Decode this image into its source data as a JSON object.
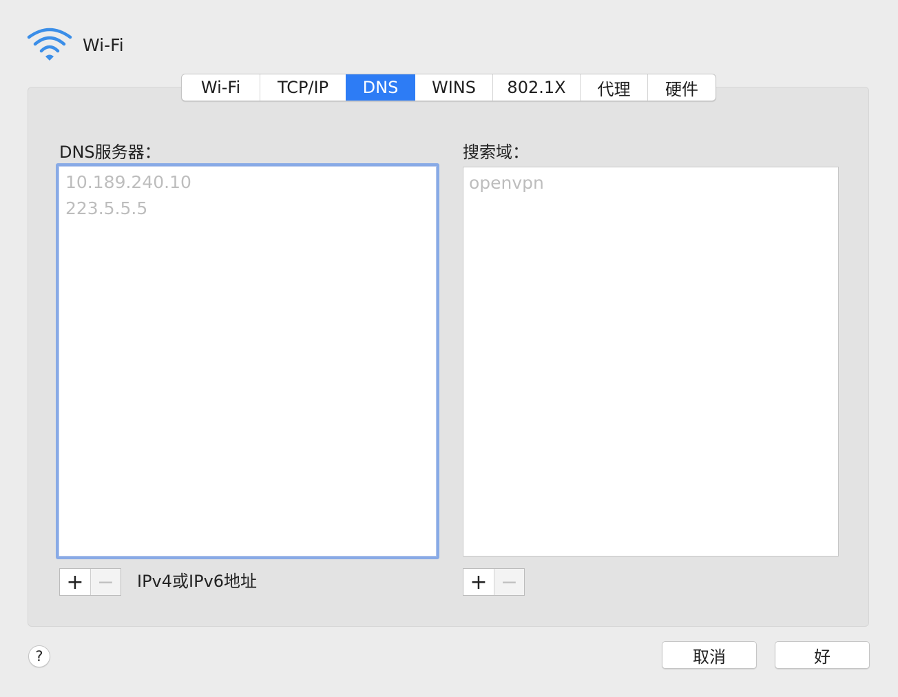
{
  "window": {
    "title": "Wi-Fi",
    "icon": "wifi-icon",
    "accent_color": "#2d7cf5"
  },
  "tabs": [
    {
      "label": "Wi-Fi",
      "active": false
    },
    {
      "label": "TCP/IP",
      "active": false
    },
    {
      "label": "DNS",
      "active": true
    },
    {
      "label": "WINS",
      "active": false
    },
    {
      "label": "802.1X",
      "active": false
    },
    {
      "label": "代理",
      "active": false
    },
    {
      "label": "硬件",
      "active": false
    }
  ],
  "dns_servers": {
    "label": "DNS服务器：",
    "items": [
      "10.189.240.10",
      "223.5.5.5"
    ],
    "add_label": "+",
    "remove_label": "−",
    "hint": "IPv4或IPv6地址"
  },
  "search_domains": {
    "label": "搜索域：",
    "items": [
      "openvpn"
    ],
    "add_label": "+",
    "remove_label": "−"
  },
  "footer": {
    "help_label": "?",
    "cancel_label": "取消",
    "ok_label": "好"
  }
}
